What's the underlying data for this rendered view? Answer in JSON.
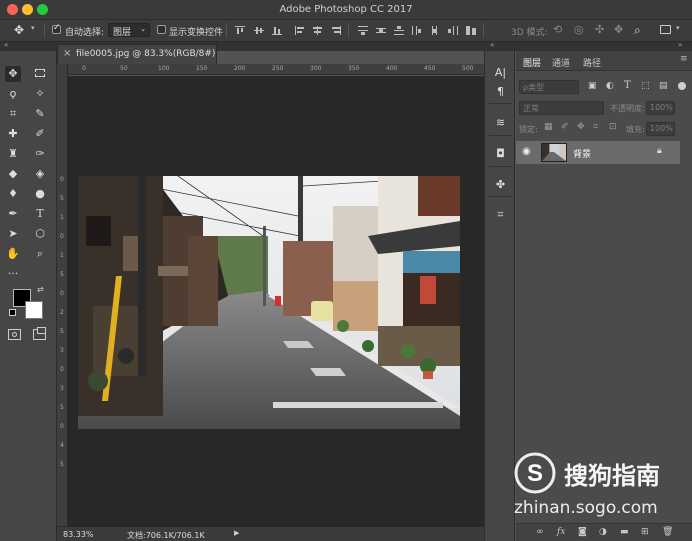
{
  "window": {
    "title": "Adobe Photoshop CC 2017",
    "traffic_lights": {
      "close": "#ff5f57",
      "minimize": "#ffbd2e",
      "zoom": "#28c840"
    }
  },
  "options_bar": {
    "auto_select_label": "自动选择:",
    "auto_select_value": "图层",
    "show_transform_label": "显示变换控件",
    "mode_3d_label": "3D 模式:"
  },
  "document": {
    "tab_label": "file0005.jpg @ 83.3%(RGB/8#)",
    "zoom": "83.33%",
    "doc_info": "文档:706.1K/706.1K",
    "h_ruler_ticks": [
      "0",
      "50",
      "100",
      "150",
      "200",
      "250",
      "300",
      "350",
      "400",
      "450",
      "500"
    ],
    "v_ruler_ticks": [
      "0",
      "5",
      "1",
      "0",
      "1",
      "5",
      "0",
      "2",
      "5",
      "3",
      "0",
      "3",
      "5",
      "0",
      "4",
      "5"
    ]
  },
  "tools": {
    "foreground_color": "#000000",
    "background_color": "#ffffff"
  },
  "layers_panel": {
    "tabs": [
      "图层",
      "通道",
      "路径"
    ],
    "filter_placeholder": "ρ类型",
    "blend_mode": "正常",
    "opacity_label": "不透明度:",
    "opacity_value": "100%",
    "lock_label": "锁定:",
    "fill_label": "填充:",
    "fill_value": "100%",
    "layer_name": "背景",
    "bottom_icons": [
      "fx"
    ]
  },
  "watermark": {
    "brand": "搜狗指南",
    "url": "zhinan.sogo.com"
  }
}
